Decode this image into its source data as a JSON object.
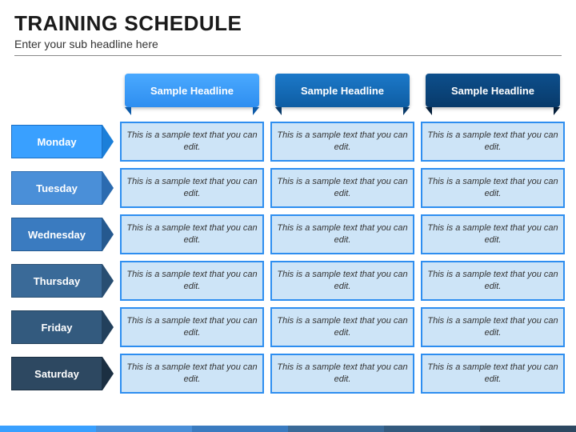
{
  "header": {
    "title": "TRAINING SCHEDULE",
    "subtitle": "Enter your sub headline here"
  },
  "columns": [
    {
      "label": "Sample Headline"
    },
    {
      "label": "Sample Headline"
    },
    {
      "label": "Sample Headline"
    }
  ],
  "rows": [
    {
      "label": "Monday",
      "cells": [
        "This is a sample text that you can edit.",
        "This is a sample text that you can edit.",
        "This is a sample text that you can edit."
      ]
    },
    {
      "label": "Tuesday",
      "cells": [
        "This is a sample text that you can edit.",
        "This is a sample text that you can edit.",
        "This is a sample text that you can edit."
      ]
    },
    {
      "label": "Wednesday",
      "cells": [
        "This is a sample text that you can edit.",
        "This is a sample text that you can edit.",
        "This is a sample text that you can edit."
      ]
    },
    {
      "label": "Thursday",
      "cells": [
        "This is a sample text that you can edit.",
        "This is a sample text that you can edit.",
        "This is a sample text that you can edit."
      ]
    },
    {
      "label": "Friday",
      "cells": [
        "This is a sample text that you can edit.",
        "This is a sample text that you can edit.",
        "This is a sample text that you can edit."
      ]
    },
    {
      "label": "Saturday",
      "cells": [
        "This is a sample text that you can edit.",
        "This is a sample text that you can edit.",
        "This is a sample text that you can edit."
      ]
    }
  ]
}
